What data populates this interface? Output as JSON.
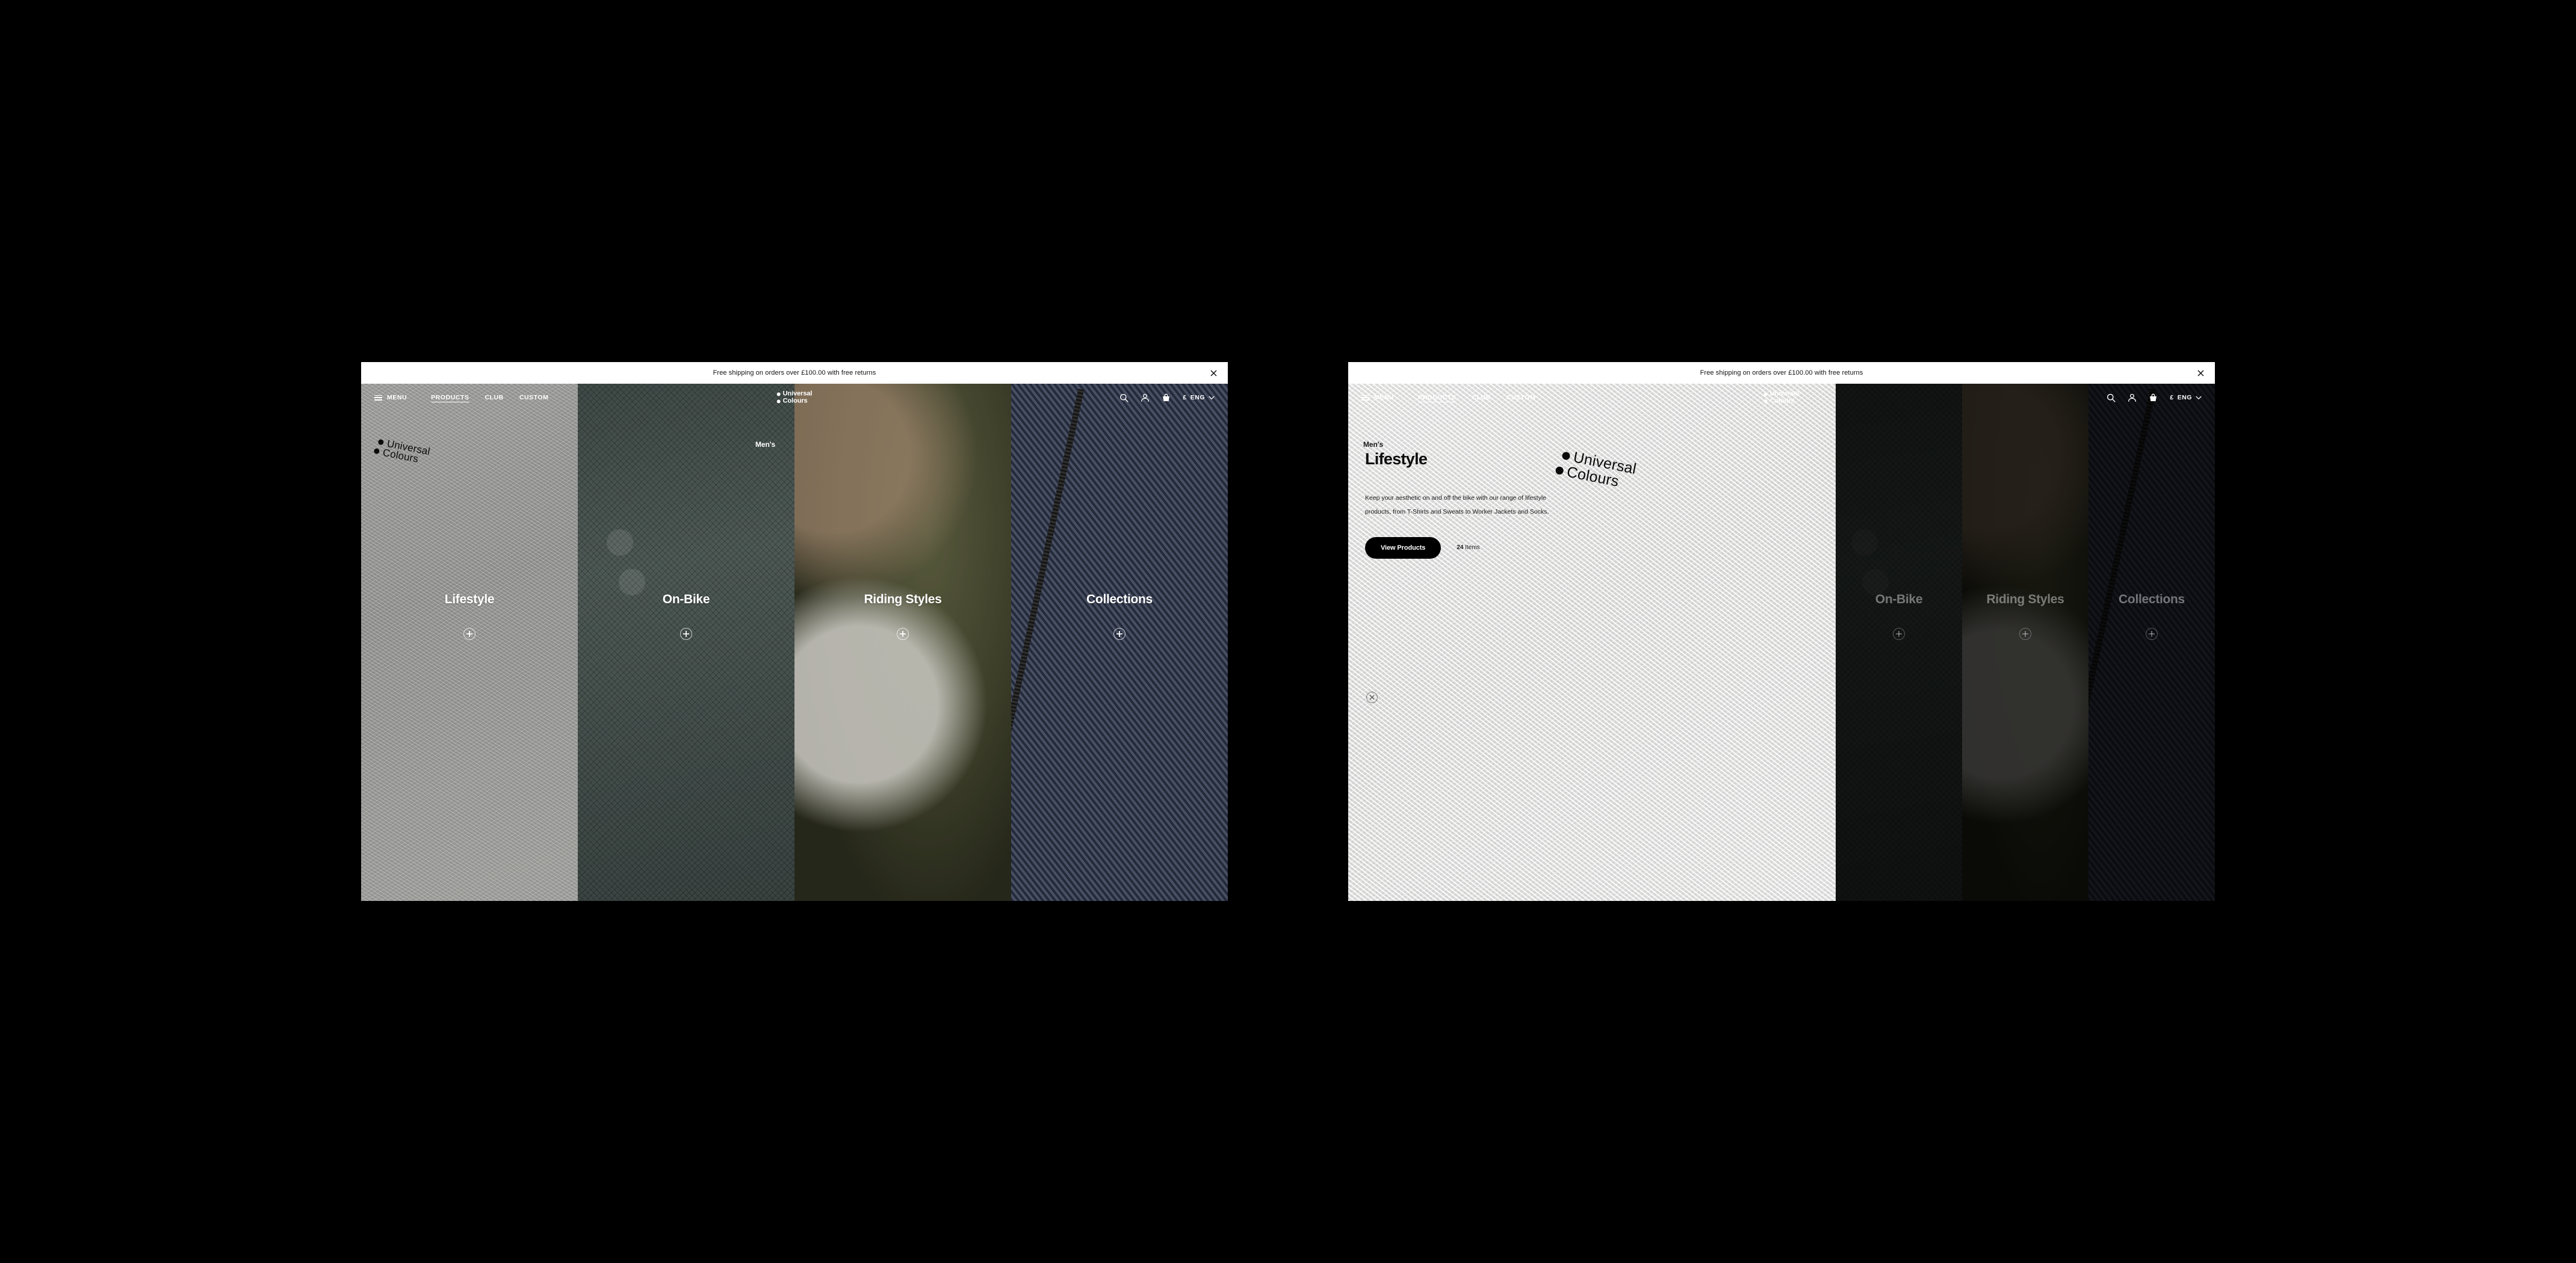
{
  "announcement": {
    "text": "Free shipping on orders over £100.00 with free returns",
    "close_icon": "close-icon"
  },
  "nav": {
    "menu_label": "MENU",
    "menu_icon": "hamburger-icon",
    "links": [
      {
        "label": "PRODUCTS",
        "active": true
      },
      {
        "label": "CLUB",
        "active": false
      },
      {
        "label": "CUSTOM",
        "active": false
      }
    ],
    "brand": {
      "line1": "Universal",
      "line2": "Colours"
    },
    "icons": [
      {
        "name": "search-icon"
      },
      {
        "name": "account-icon"
      },
      {
        "name": "basket-icon"
      }
    ],
    "locale": {
      "currency": "£",
      "language": "ENG",
      "chevron_icon": "chevron-down-icon"
    }
  },
  "gender_label": "Men's",
  "categories": [
    {
      "label": "Lifestyle",
      "plus_icon": "plus-circle-icon"
    },
    {
      "label": "On-Bike",
      "plus_icon": "plus-circle-icon"
    },
    {
      "label": "Riding Styles",
      "plus_icon": "plus-circle-icon"
    },
    {
      "label": "Collections",
      "plus_icon": "plus-circle-icon"
    }
  ],
  "expanded": {
    "title": "Lifestyle",
    "description": "Keep your aesthetic on and off the bike with our range of lifestyle products, from T-Shirts and Sweats to Worker Jackets and Socks.",
    "cta_label": "View Products",
    "item_count": "24",
    "item_count_suffix": "Items",
    "close_icon": "close-circle-icon",
    "watermark": {
      "line1": "Universal",
      "line2": "Colours"
    }
  },
  "colors": {
    "background": "#000000",
    "announcement_bg": "#ffffff",
    "cta_bg": "#000000",
    "cta_text": "#ffffff",
    "nav_text": "#ffffff"
  }
}
